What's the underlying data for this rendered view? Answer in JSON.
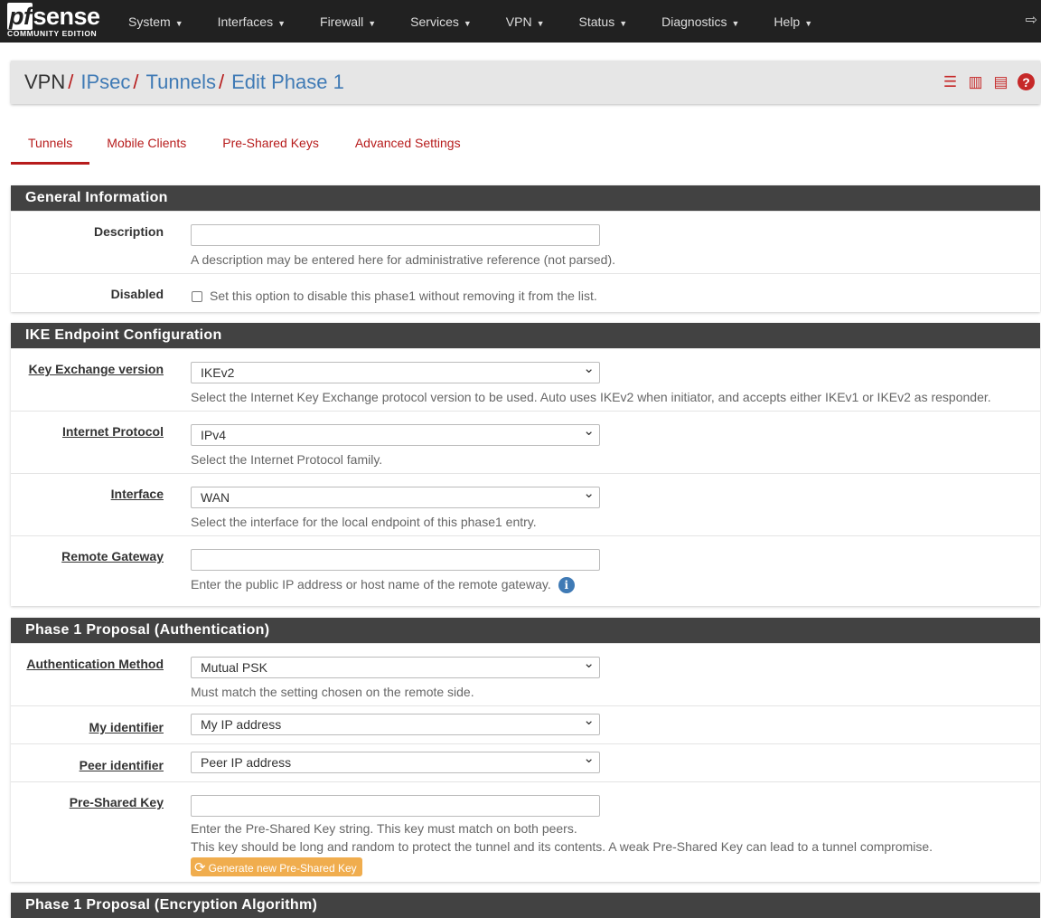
{
  "nav": {
    "logo_main": "pfsense",
    "logo_pf": "pf",
    "logo_rest": "sense",
    "logo_sub": "COMMUNITY EDITION",
    "items": [
      "System",
      "Interfaces",
      "Firewall",
      "Services",
      "VPN",
      "Status",
      "Diagnostics",
      "Help"
    ]
  },
  "breadcrumb": [
    "VPN",
    "IPsec",
    "Tunnels",
    "Edit Phase 1"
  ],
  "tabs": [
    "Tunnels",
    "Mobile Clients",
    "Pre-Shared Keys",
    "Advanced Settings"
  ],
  "general": {
    "title": "General Information",
    "description_label": "Description",
    "description_value": "",
    "description_help": "A description may be entered here for administrative reference (not parsed).",
    "disabled_label": "Disabled",
    "disabled_help": "Set this option to disable this phase1 without removing it from the list."
  },
  "ike": {
    "title": "IKE Endpoint Configuration",
    "kev_label": "Key Exchange version",
    "kev_value": "IKEv2",
    "kev_help": "Select the Internet Key Exchange protocol version to be used. Auto uses IKEv2 when initiator, and accepts either IKEv1 or IKEv2 as responder.",
    "ip_label": "Internet Protocol",
    "ip_value": "IPv4",
    "ip_help": "Select the Internet Protocol family.",
    "if_label": "Interface",
    "if_value": "WAN",
    "if_help": "Select the interface for the local endpoint of this phase1 entry.",
    "rg_label": "Remote Gateway",
    "rg_value": "",
    "rg_help": "Enter the public IP address or host name of the remote gateway."
  },
  "auth": {
    "title": "Phase 1 Proposal (Authentication)",
    "am_label": "Authentication Method",
    "am_value": "Mutual PSK",
    "am_help": "Must match the setting chosen on the remote side.",
    "myid_label": "My identifier",
    "myid_value": "My IP address",
    "peerid_label": "Peer identifier",
    "peerid_value": "Peer IP address",
    "psk_label": "Pre-Shared Key",
    "psk_value": "",
    "psk_help1": "Enter the Pre-Shared Key string. This key must match on both peers.",
    "psk_help2": "This key should be long and random to protect the tunnel and its contents. A weak Pre-Shared Key can lead to a tunnel compromise.",
    "generate_label": "Generate new Pre-Shared Key"
  },
  "enc": {
    "title": "Phase 1 Proposal (Encryption Algorithm)"
  }
}
